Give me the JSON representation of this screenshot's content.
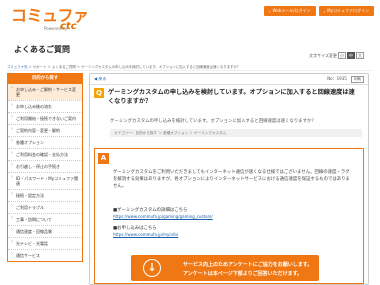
{
  "header": {
    "logo_text": "コミュファ",
    "logo_powered": "Powered by",
    "logo_ctc": "ctc",
    "links": [
      {
        "label": "Webメール/ログイン",
        "icon": "chevron-right-icon"
      },
      {
        "label": "Myコミュファログイン",
        "icon": "chevron-right-icon"
      }
    ]
  },
  "page": {
    "title": "よくあるご質問",
    "font_size_label": "文字サイズ変更",
    "font_sizes": [
      "小",
      "中",
      "大"
    ],
    "breadcrumb": [
      "コミュファ光",
      "サポート",
      "よくあるご質問",
      "ゲーミングカスタムの申し込みを検討しています。オプションに加入すると回線速度は速くなりますか？"
    ]
  },
  "sidebar": {
    "title": "目的から探す",
    "items": [
      "お申し込み・ご解約・サービス変更",
      "お申し込み後の流れ",
      "ご利用開始・接続できないご案内",
      "ご契約内容・変更・解約",
      "各種オプション",
      "ご利用料金の確認・支払方法",
      "お引越し・停止の手続き",
      "ID・パスワード・Myコミュファ関連",
      "接続・設定方法",
      "ご利用トラブル",
      "工事・訪問について",
      "通信速度・回線品質",
      "光テレビ・光電話",
      "通信サービス"
    ],
    "selected_index": 0
  },
  "main": {
    "back_label": "戻る",
    "number_label": "No：1935",
    "print_label": "印刷",
    "question": "ゲーミングカスタムの申し込みを検討しています。オプションに加入すると回線速度は速くなりますか？",
    "question_sub": "ゲーミングカスタムの申し込みを検討しています。オプションに加入すると回線速度は速くなりますか？",
    "category": "カテゴリー：目的から探す ＞ 各種オプション ＞ ゲーミングカスタム",
    "answer": "ゲーミングカスタムをご利用いただきましてもインターネット通信が速くなる仕様ではございません。回線の速度・ラグを解消する効果はありますが、各オプションによりインターネットサービスにおける通信速度を保証するものではありません。",
    "link1_label": "■ゲーミングカスタムの詳細はこちら",
    "link1_url": "https://www.commufa.jp/gaming/gaming_custom/",
    "link2_label": "■お申し込みはこちら",
    "link2_url": "https://www.commufa.jp/myinfo/",
    "survey_line1": "サービス向上のためアンケートにご協力をお願いします。",
    "survey_line2": "アンケートは本ページ下部よりご回答いただけます。"
  }
}
